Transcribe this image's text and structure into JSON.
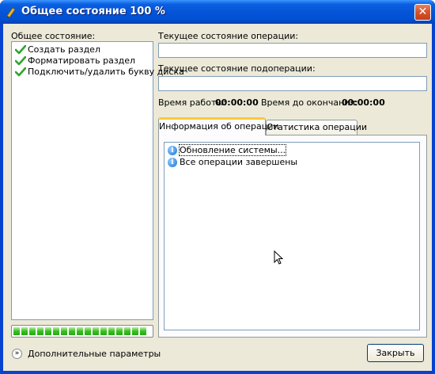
{
  "window": {
    "title": "Общее состояние 100 %",
    "close_glyph": "✕"
  },
  "left_panel": {
    "label": "Общее состояние:",
    "operations": [
      {
        "label": "Создать раздел",
        "icon": "check-icon"
      },
      {
        "label": "Форматировать раздел",
        "icon": "check-icon"
      },
      {
        "label": "Подключить/удалить букву диска",
        "icon": "check-icon"
      }
    ],
    "progress_fraction": 1.0
  },
  "right_panel": {
    "current_op_label": "Текущее состояние операции:",
    "current_op_value": "",
    "current_subop_label": "Текущее состояние подоперации:",
    "current_subop_value": "",
    "elapsed_label": "Время работы:",
    "elapsed_value": "00:00:00",
    "remaining_label": "Время до окончания:",
    "remaining_value": "00:00:00"
  },
  "tabs": [
    {
      "label": "Информация об операции",
      "active": true
    },
    {
      "label": "Статистика операции",
      "active": false
    }
  ],
  "info_log": [
    {
      "text": "Обновление системы...",
      "icon": "info-icon"
    },
    {
      "text": "Все операции завершены",
      "icon": "info-icon"
    }
  ],
  "footer": {
    "more_params_label": "Дополнительные параметры",
    "close_button_label": "Закрыть"
  },
  "colors": {
    "titlebar": "#0054e3",
    "client_bg": "#ece9d8",
    "progress_green": "#37c023",
    "tab_highlight": "#ffc73c"
  }
}
